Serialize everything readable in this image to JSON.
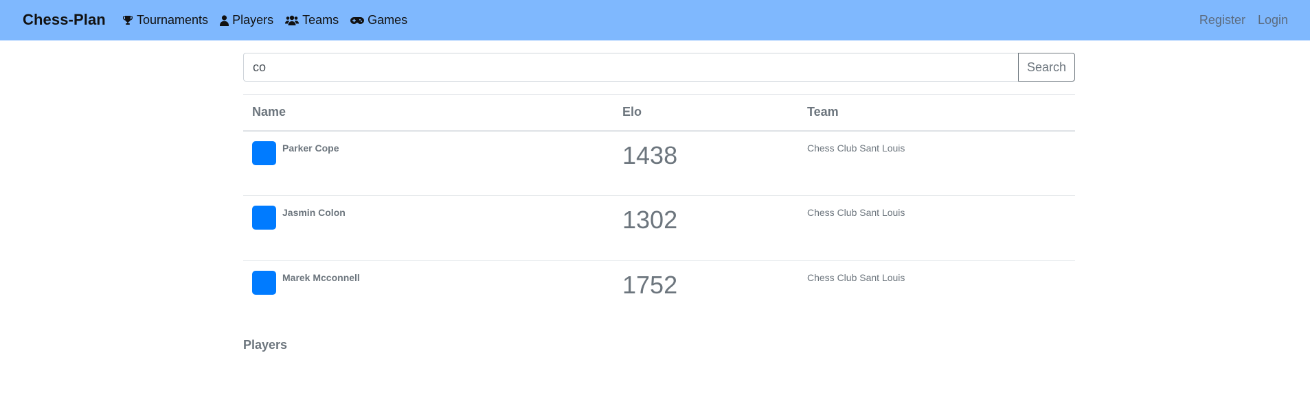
{
  "navbar": {
    "brand": "Chess-Plan",
    "links": [
      {
        "label": "Tournaments",
        "icon": "trophy-icon"
      },
      {
        "label": "Players",
        "icon": "user-icon"
      },
      {
        "label": "Teams",
        "icon": "users-icon"
      },
      {
        "label": "Games",
        "icon": "gamepad-icon"
      }
    ],
    "right": {
      "register": "Register",
      "login": "Login"
    },
    "background": "#7fb8fe"
  },
  "search": {
    "value": "co",
    "button_label": "Search"
  },
  "table": {
    "headers": {
      "name": "Name",
      "elo": "Elo",
      "team": "Team"
    },
    "rows": [
      {
        "name": "Parker Cope",
        "elo": "1438",
        "team": "Chess Club Sant Louis"
      },
      {
        "name": "Jasmin Colon",
        "elo": "1302",
        "team": "Chess Club Sant Louis"
      },
      {
        "name": "Marek Mcconnell",
        "elo": "1752",
        "team": "Chess Club Sant Louis"
      }
    ]
  },
  "section": {
    "title": "Players"
  },
  "colors": {
    "avatar": "#007bff",
    "text_muted": "#6c757d"
  }
}
